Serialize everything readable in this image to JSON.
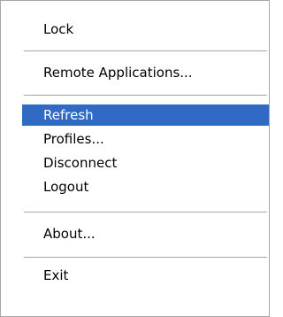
{
  "menu": {
    "items": [
      {
        "label": "Lock"
      },
      {
        "label": "Remote Applications..."
      },
      {
        "label": "Refresh",
        "selected": true
      },
      {
        "label": "Profiles..."
      },
      {
        "label": "Disconnect"
      },
      {
        "label": "Logout"
      },
      {
        "label": "About..."
      },
      {
        "label": "Exit"
      }
    ]
  },
  "colors": {
    "selection": "#316ac5",
    "separator": "#aca899",
    "border": "#a6a6a6"
  }
}
